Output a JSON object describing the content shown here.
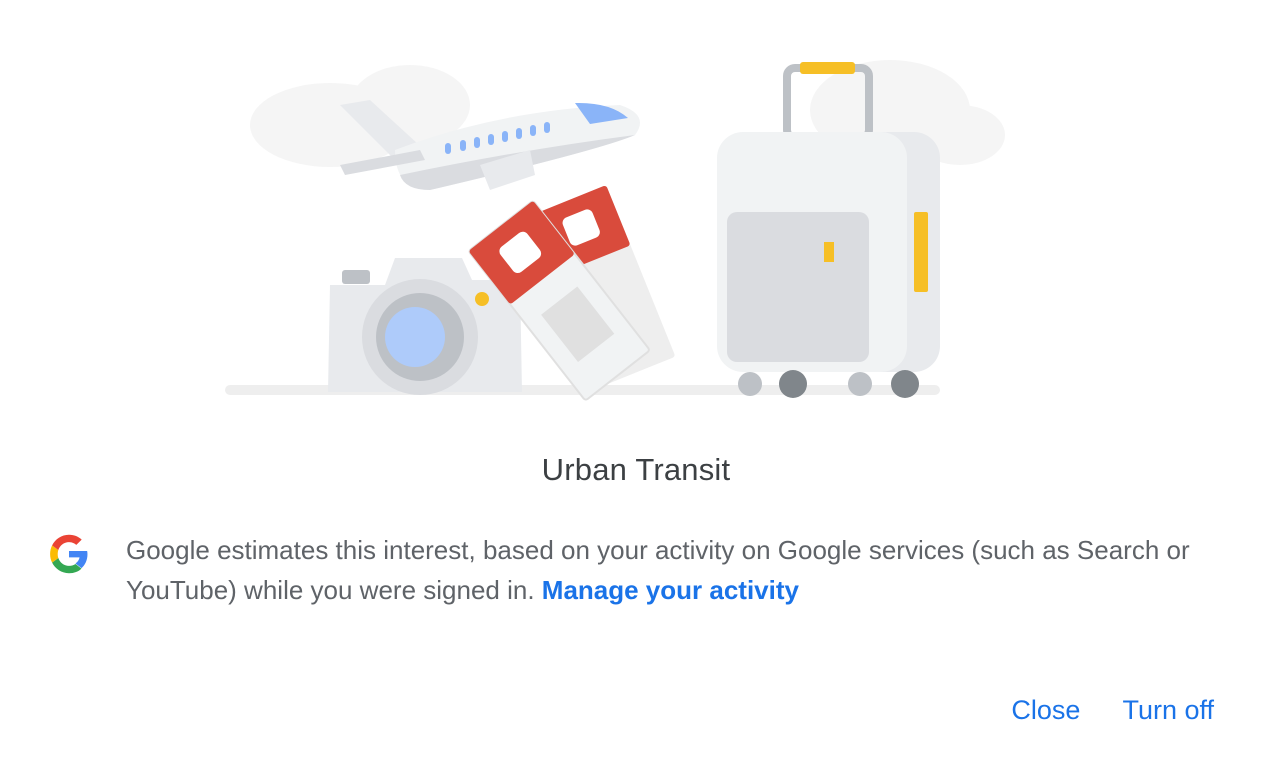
{
  "dialog": {
    "title": "Urban Transit",
    "description": "Google estimates this interest, based on your activity on Google services (such as Search or YouTube) while you were signed in. ",
    "manage_link": "Manage your activity",
    "close_label": "Close",
    "turn_off_label": "Turn off"
  },
  "colors": {
    "link_blue": "#1a73e8",
    "title_text": "#3c4043",
    "body_text": "#5f6368",
    "ticket_red": "#d94b3c",
    "accent_yellow": "#f6bf26"
  },
  "illustration_icons": [
    "airplane-icon",
    "camera-icon",
    "train-ticket-icon",
    "suitcase-icon",
    "google-logo-icon"
  ]
}
